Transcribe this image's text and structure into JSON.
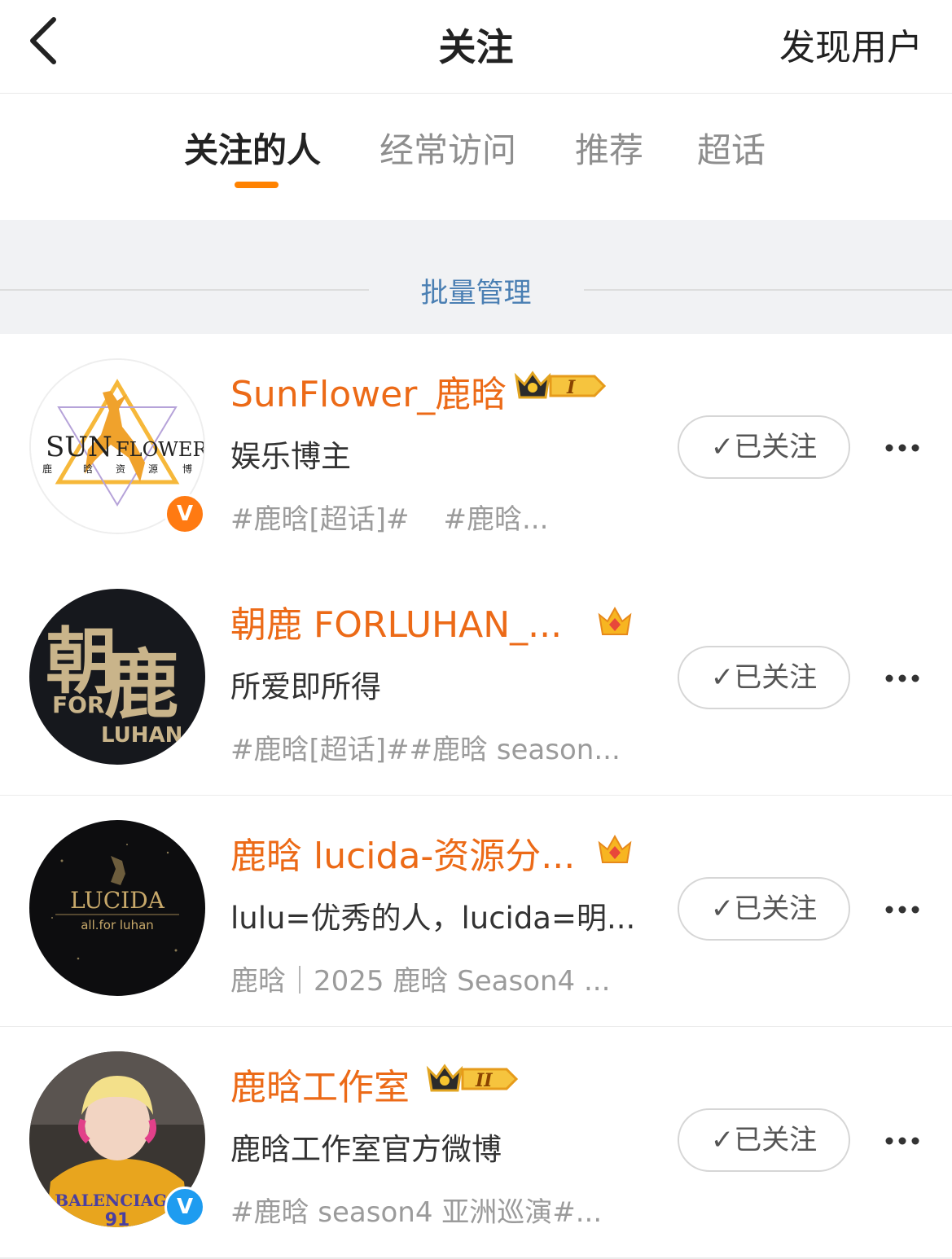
{
  "header": {
    "back_icon": "chevron-left-icon",
    "title": "关注",
    "discover_label": "发现用户"
  },
  "tabs": [
    {
      "label": "关注的人",
      "active": true
    },
    {
      "label": "经常访问",
      "active": false
    },
    {
      "label": "推荐",
      "active": false
    },
    {
      "label": "超话",
      "active": false
    }
  ],
  "batch_manage_label": "批量管理",
  "follow_label": "已关注",
  "users": [
    {
      "name": "SunFlower_鹿晗",
      "desc": "娱乐博主",
      "tags": [
        "#鹿晗[超话]#",
        "#鹿晗..."
      ],
      "vip": "crown-I",
      "verify": "V",
      "avatar_text": [
        "SUN",
        "FLOWER",
        "鹿",
        "晗",
        "资",
        "源",
        "博"
      ]
    },
    {
      "name": "朝鹿 FORLUHAN_...",
      "desc": "所爱即所得",
      "tags": [
        "#鹿晗[超话]##鹿晗 season..."
      ],
      "vip": "crown-red",
      "avatar_text": [
        "朝",
        "鹿",
        "FOR",
        "LUHAN"
      ]
    },
    {
      "name": "鹿晗 lucida-资源分...",
      "desc": "lulu=优秀的人，lucida=明...",
      "tags": [
        "鹿晗｜2025 鹿晗 Season4 ..."
      ],
      "vip": "crown-red",
      "avatar_text": [
        "LUCIDA",
        "all.for luhan"
      ]
    },
    {
      "name": "鹿晗工作室",
      "desc": "鹿晗工作室官方微博",
      "tags": [
        "#鹿晗 season4 亚洲巡演#..."
      ],
      "vip": "crown-II",
      "verify": "V",
      "avatar_text": [
        "BALENCIAGA",
        "91"
      ]
    }
  ],
  "colors": {
    "accent": "#ff8200",
    "name": "#ec6a17",
    "link": "#4a7fb3",
    "band": "#f1f2f4",
    "verify_orange": "#ff7a12",
    "verify_blue": "#1e9cf0"
  }
}
